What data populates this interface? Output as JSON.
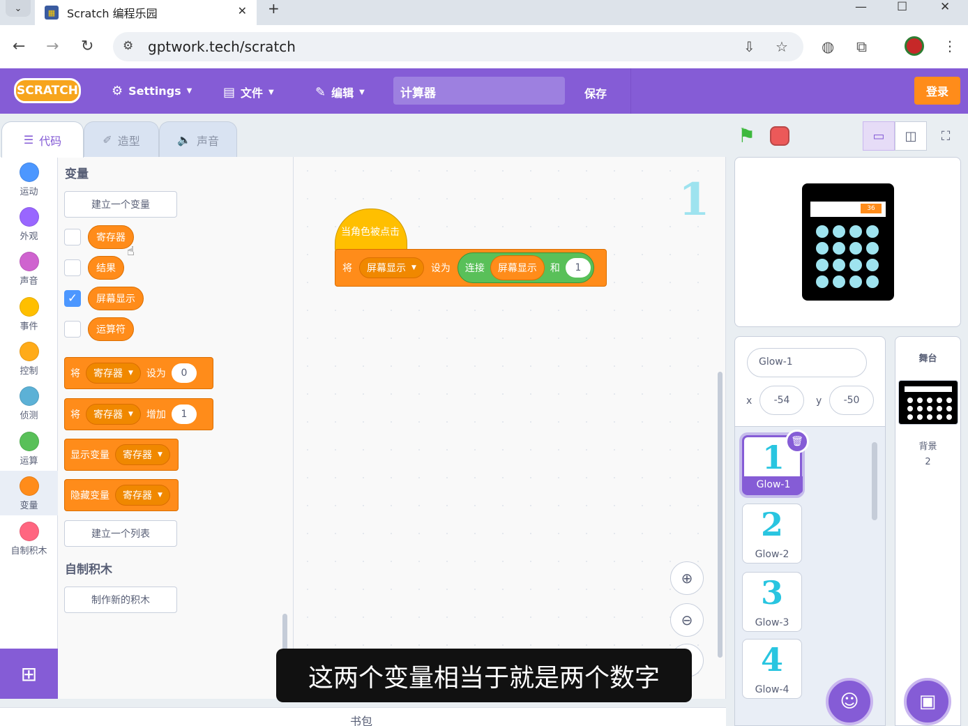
{
  "browser": {
    "tab_title": "Scratch 编程乐园",
    "url": "gptwork.tech/scratch"
  },
  "menubar": {
    "logo": "SCRATCH",
    "settings": "Settings",
    "file": "文件",
    "edit": "编辑",
    "project_title": "计算器",
    "save": "保存",
    "login": "登录"
  },
  "editor_tabs": [
    "代码",
    "造型",
    "声音"
  ],
  "categories": [
    {
      "label": "运动",
      "color": "#4c97ff"
    },
    {
      "label": "外观",
      "color": "#9966ff"
    },
    {
      "label": "声音",
      "color": "#cf63cf"
    },
    {
      "label": "事件",
      "color": "#ffbf00"
    },
    {
      "label": "控制",
      "color": "#ffab19"
    },
    {
      "label": "侦测",
      "color": "#5cb1d6"
    },
    {
      "label": "运算",
      "color": "#59c059"
    },
    {
      "label": "变量",
      "color": "#ff8c1a"
    },
    {
      "label": "自制积木",
      "color": "#ff6680"
    }
  ],
  "palette": {
    "heading_variables": "变量",
    "make_variable": "建立一个变量",
    "variables": [
      "寄存器",
      "结果",
      "屏幕显示",
      "运算符"
    ],
    "set_block": {
      "verb": "将",
      "var": "寄存器",
      "op": "设为",
      "value": "0"
    },
    "change_block": {
      "verb": "将",
      "var": "寄存器",
      "op": "增加",
      "value": "1"
    },
    "show_block": {
      "label": "显示变量",
      "var": "寄存器"
    },
    "hide_block": {
      "label": "隐藏变量",
      "var": "寄存器"
    },
    "make_list": "建立一个列表",
    "heading_custom": "自制积木",
    "make_block": "制作新的积木"
  },
  "script": {
    "sprite_glyph": "1",
    "hat": "当角色被点击",
    "set_verb": "将",
    "set_var": "屏幕显示",
    "set_op": "设为",
    "join_label": "连接",
    "join_reporter": "屏幕显示",
    "join_and": "和",
    "join_value": "1"
  },
  "subtitle": "这两个变量相当于就是两个数字",
  "backpack": "书包",
  "stage": {
    "display_value": "36"
  },
  "sprite_info": {
    "name": "Glow-1",
    "x_label": "x",
    "x": "-54",
    "y_label": "y",
    "y": "-50"
  },
  "sprites": [
    {
      "glyph": "1",
      "name": "Glow-1"
    },
    {
      "glyph": "2",
      "name": "Glow-2"
    },
    {
      "glyph": "3",
      "name": "Glow-3"
    },
    {
      "glyph": "4",
      "name": "Glow-4"
    }
  ],
  "stage_pane": {
    "title": "舞台",
    "backdrop_label": "背景",
    "backdrop_count": "2"
  }
}
